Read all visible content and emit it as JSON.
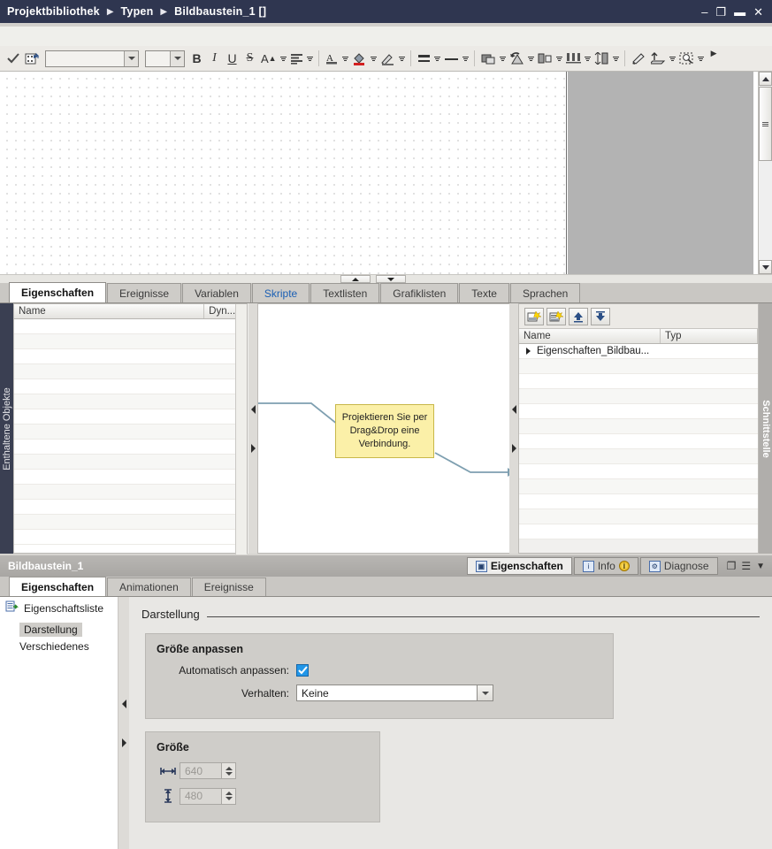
{
  "window": {
    "breadcrumb": [
      "Projektbibliothek",
      "Typen",
      "Bildbaustein_1 []"
    ],
    "controls": {
      "minimize": "minimize-icon",
      "restore": "restore-icon",
      "maximize": "maximize-icon",
      "close": "close-icon"
    }
  },
  "toolbar": {
    "apply_icon": "checkmark-icon",
    "insert_icon": "insert-object-icon",
    "font_family_value": "",
    "font_size_value": "",
    "bold": "B",
    "italic": "I",
    "underline": "U",
    "strikethrough": "S",
    "superscript": "A",
    "align_icon": "align-text-icon",
    "font_color_icon": "font-color-icon",
    "fill_color_icon": "fill-color-icon",
    "line_color_icon": "line-color-icon",
    "line_weight_icon": "line-weight-icon",
    "line_style_icon": "line-style-icon",
    "bring_front_icon": "arrange-order-icon",
    "rotate_icon": "rotate-icon",
    "align_objects_icon": "align-objects-icon",
    "distribute_h_icon": "distribute-horizontal-icon",
    "distribute_v_icon": "distribute-vertical-icon",
    "format_painter_icon": "format-painter-icon",
    "export_icon": "export-style-icon",
    "zoom_icon": "zoom-area-icon",
    "overflow_icon": "toolbar-overflow-icon"
  },
  "editor": {
    "scroll_up_icon": "scroll-up-icon",
    "scroll_down_icon": "scroll-down-icon",
    "hscroll_up_icon": "scroll-up-small-icon",
    "hscroll_down_icon": "scroll-down-small-icon"
  },
  "main_tabs": [
    {
      "label": "Eigenschaften",
      "state": "active"
    },
    {
      "label": "Ereignisse",
      "state": "normal"
    },
    {
      "label": "Variablen",
      "state": "normal"
    },
    {
      "label": "Skripte",
      "state": "link"
    },
    {
      "label": "Textlisten",
      "state": "normal"
    },
    {
      "label": "Grafiklisten",
      "state": "normal"
    },
    {
      "label": "Texte",
      "state": "normal"
    },
    {
      "label": "Sprachen",
      "state": "normal"
    }
  ],
  "rails": {
    "left_label": "Enthaltene Objekte",
    "right_label": "Schnittstelle"
  },
  "left_panel": {
    "columns": [
      "Name",
      "Dyn..."
    ]
  },
  "center_panel": {
    "note_text": "Projektieren Sie per Drag&Drop eine Verbindung."
  },
  "right_panel": {
    "toolbar_icons": [
      "new-entry-icon",
      "new-group-icon",
      "move-up-icon",
      "move-down-icon"
    ],
    "columns": [
      "Name",
      "Typ"
    ],
    "rows": [
      {
        "name": "Eigenschaften_Bildbau...",
        "typ": ""
      }
    ]
  },
  "inspector": {
    "title": "Bildbaustein_1",
    "top_tabs": [
      {
        "label": "Eigenschaften",
        "icon": "properties-icon",
        "state": "active"
      },
      {
        "label": "Info",
        "icon": "info-icon",
        "badge": "i",
        "state": "normal"
      },
      {
        "label": "Diagnose",
        "icon": "diagnostics-icon",
        "state": "normal"
      }
    ],
    "window_controls": [
      "undock-icon",
      "list-icon",
      "chevron-down-icon"
    ],
    "tabs": [
      {
        "label": "Eigenschaften",
        "state": "active"
      },
      {
        "label": "Animationen",
        "state": "normal"
      },
      {
        "label": "Ereignisse",
        "state": "normal"
      }
    ],
    "nav": {
      "root": {
        "label": "Eigenschaftsliste",
        "icon": "property-list-icon"
      },
      "items": [
        {
          "label": "Darstellung",
          "selected": true
        },
        {
          "label": "Verschiedenes",
          "selected": false
        }
      ]
    },
    "section_title": "Darstellung",
    "groups": [
      {
        "title": "Größe anpassen",
        "fields": [
          {
            "type": "checkbox",
            "label": "Automatisch anpassen:",
            "checked": true
          },
          {
            "type": "select",
            "label": "Verhalten:",
            "value": "Keine"
          }
        ]
      },
      {
        "title": "Größe",
        "fields": [
          {
            "type": "spinner",
            "icon": "width-icon",
            "value": "640"
          },
          {
            "type": "spinner",
            "icon": "height-icon",
            "value": "480"
          }
        ]
      }
    ]
  }
}
